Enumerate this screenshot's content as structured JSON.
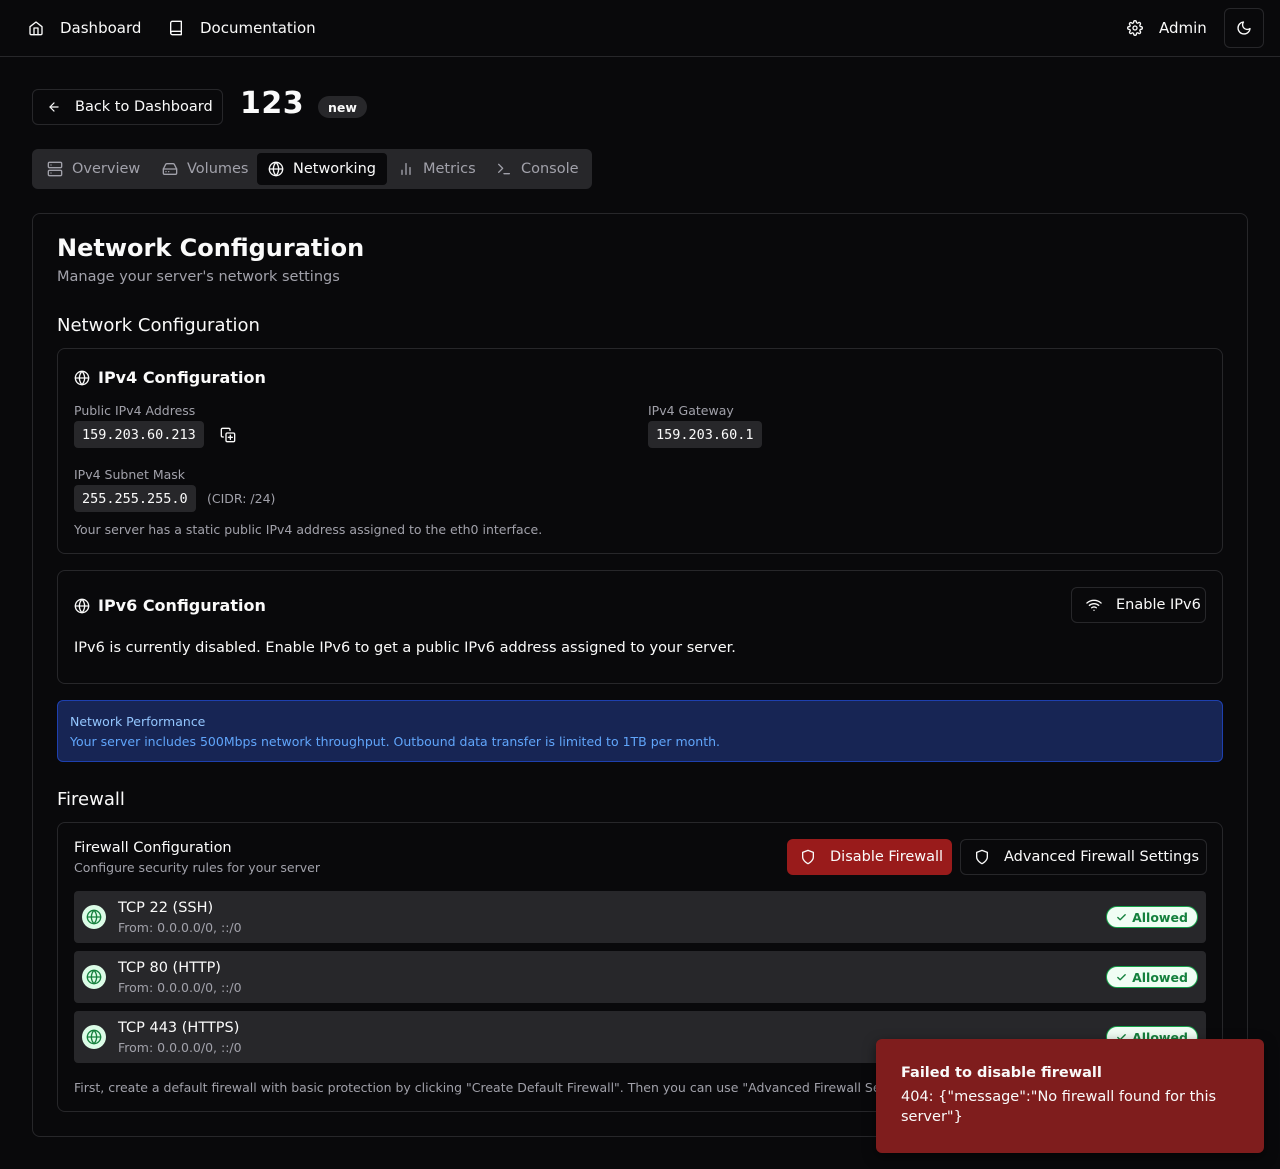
{
  "topnav": {
    "dashboard_label": "Dashboard",
    "documentation_label": "Documentation",
    "admin_label": "Admin"
  },
  "header": {
    "back_label": "Back to Dashboard",
    "server_name": "123",
    "status_badge": "new"
  },
  "tabs": [
    {
      "label": "Overview",
      "icon": "server-icon"
    },
    {
      "label": "Volumes",
      "icon": "hard-drive-icon"
    },
    {
      "label": "Networking",
      "icon": "globe-icon",
      "active": true
    },
    {
      "label": "Metrics",
      "icon": "bar-chart-icon"
    },
    {
      "label": "Console",
      "icon": "terminal-icon"
    }
  ],
  "page": {
    "title": "Network Configuration",
    "subtitle": "Manage your server's network settings",
    "network_section_heading": "Network Configuration",
    "firewall_section_heading": "Firewall"
  },
  "ipv4": {
    "title": "IPv4 Configuration",
    "public_label": "Public IPv4 Address",
    "public_value": "159.203.60.213",
    "gateway_label": "IPv4 Gateway",
    "gateway_value": "159.203.60.1",
    "subnet_label": "IPv4 Subnet Mask",
    "subnet_value": "255.255.255.0",
    "cidr": "(CIDR: /24)",
    "note": "Your server has a static public IPv4 address assigned to the eth0 interface."
  },
  "ipv6": {
    "title": "IPv6 Configuration",
    "enable_label": "Enable IPv6",
    "status_text": "IPv6 is currently disabled. Enable IPv6 to get a public IPv6 address assigned to your server."
  },
  "performance": {
    "title": "Network Performance",
    "text": "Your server includes 500Mbps network throughput. Outbound data transfer is limited to 1TB per month."
  },
  "firewall": {
    "title": "Firewall Configuration",
    "subtitle": "Configure security rules for your server",
    "disable_label": "Disable Firewall",
    "advanced_label": "Advanced Firewall Settings",
    "rules": [
      {
        "name": "TCP 22 (SSH)",
        "source": "From: 0.0.0.0/0, ::/0",
        "status": "Allowed"
      },
      {
        "name": "TCP 80 (HTTP)",
        "source": "From: 0.0.0.0/0, ::/0",
        "status": "Allowed"
      },
      {
        "name": "TCP 443 (HTTPS)",
        "source": "From: 0.0.0.0/0, ::/0",
        "status": "Allowed"
      }
    ],
    "footnote": "First, create a default firewall with basic protection by clicking \"Create Default Firewall\". Then you can use \"Advanced Firewall Settings\" to customize rules."
  },
  "toast": {
    "title": "Failed to disable firewall",
    "message": "404: {\"message\":\"No firewall found for this server\"}"
  },
  "colors": {
    "background": "#09090b",
    "border": "#27272a",
    "muted_text": "#a1a1aa",
    "danger": "#991b1b",
    "toast": "#7f1d1d",
    "info_bg": "#172554",
    "info_text": "#60a5fa",
    "success": "#16a34a"
  }
}
